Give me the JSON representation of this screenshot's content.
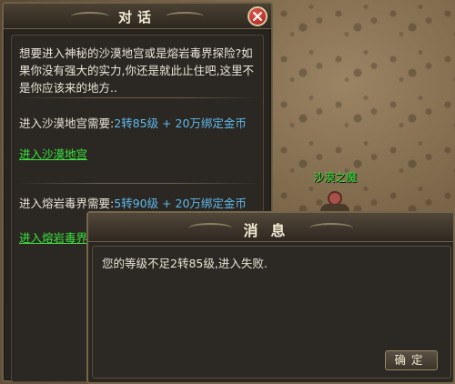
{
  "scene": {
    "npc_name": "沙漠之魔"
  },
  "dialog": {
    "title": "对话",
    "intro": "想要进入神秘的沙漠地宫或是熔岩毒界探险?如果你没有强大的实力,你还是就此止住吧,这里不是你应该来的地方..",
    "options": [
      {
        "req_label": "进入沙漠地宫需要:",
        "req_value": "2转85级 + 20万绑定金币",
        "link": "进入沙漠地宫"
      },
      {
        "req_label": "进入熔岩毒界需要:",
        "req_value": "5转90级 + 20万绑定金币",
        "link": "进入熔岩毒界"
      }
    ]
  },
  "message": {
    "title": "消息",
    "text": "您的等级不足2转85级,进入失败.",
    "ok_label": "确定"
  },
  "colors": {
    "link": "#39e13c",
    "requirement_value": "#5fb8ec",
    "npc_name": "#35e23a",
    "close_button": "#c23a2e"
  }
}
